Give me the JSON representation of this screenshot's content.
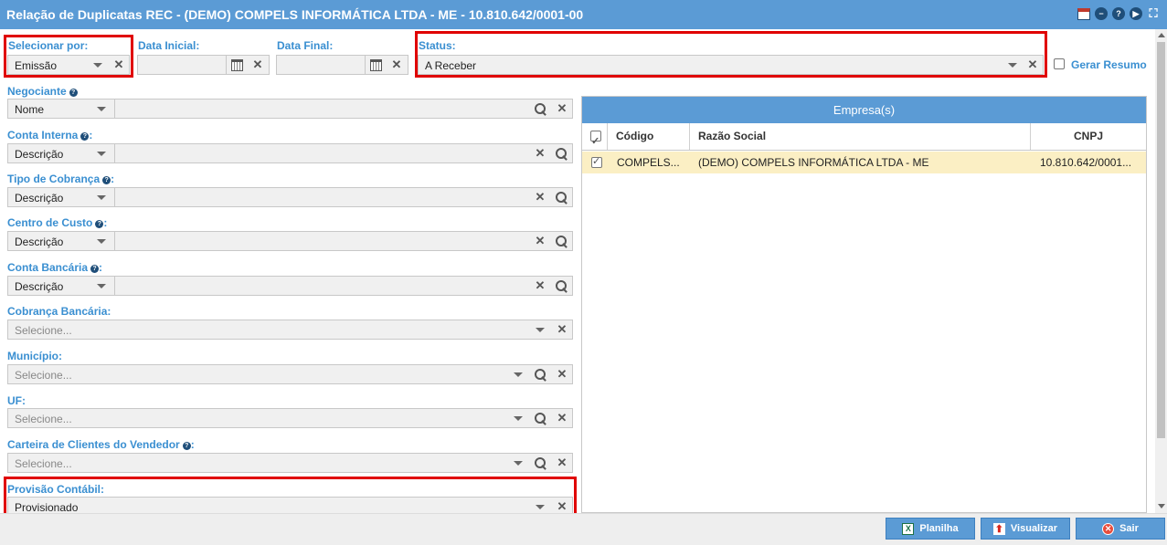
{
  "window": {
    "title": "Relação de Duplicatas REC - (DEMO) COMPELS INFORMÁTICA LTDA - ME - 10.810.642/0001-00",
    "icons": [
      "calendar-icon",
      "minimize-icon",
      "help-icon",
      "play-icon",
      "expand-icon"
    ]
  },
  "form": {
    "selecionar_por": {
      "label": "Selecionar por:",
      "value": "Emissão"
    },
    "data_inicial": {
      "label": "Data Inicial:",
      "value": ""
    },
    "data_final": {
      "label": "Data Final:",
      "value": ""
    },
    "status": {
      "label": "Status:",
      "value": "A Receber"
    },
    "gerar_resumo": {
      "label": "Gerar Resumo",
      "checked": false
    },
    "negociante": {
      "label": "Negociante",
      "select": "Nome",
      "value": ""
    },
    "conta_interna": {
      "label": "Conta Interna",
      "select": "Descrição",
      "value": ""
    },
    "tipo_cobranca": {
      "label": "Tipo de Cobrança",
      "select": "Descrição",
      "value": ""
    },
    "centro_custo": {
      "label": "Centro de Custo",
      "select": "Descrição",
      "value": ""
    },
    "conta_bancaria": {
      "label": "Conta Bancária",
      "select": "Descrição",
      "value": ""
    },
    "cobranca_bancaria": {
      "label": "Cobrança Bancária:",
      "placeholder": "Selecione..."
    },
    "municipio": {
      "label": "Município:",
      "placeholder": "Selecione..."
    },
    "uf": {
      "label": "UF:",
      "placeholder": "Selecione..."
    },
    "carteira": {
      "label": "Carteira de Clientes do Vendedor",
      "placeholder": "Selecione..."
    },
    "provisao": {
      "label": "Provisão Contábil:",
      "value": "Provisionado"
    }
  },
  "empresas": {
    "title": "Empresa(s)",
    "columns": [
      "Código",
      "Razão Social",
      "CNPJ"
    ],
    "rows": [
      {
        "checked": true,
        "codigo": "COMPELS...",
        "razao": "(DEMO) COMPELS INFORMÁTICA LTDA - ME",
        "cnpj": "10.810.642/0001..."
      }
    ]
  },
  "footer": {
    "planilha": "Planilha",
    "visualizar": "Visualizar",
    "sair": "Sair"
  },
  "colors": {
    "accent": "#5b9bd5",
    "label": "#3a8fd1",
    "highlight": "#e00000",
    "row_selected": "#fbefc4"
  }
}
